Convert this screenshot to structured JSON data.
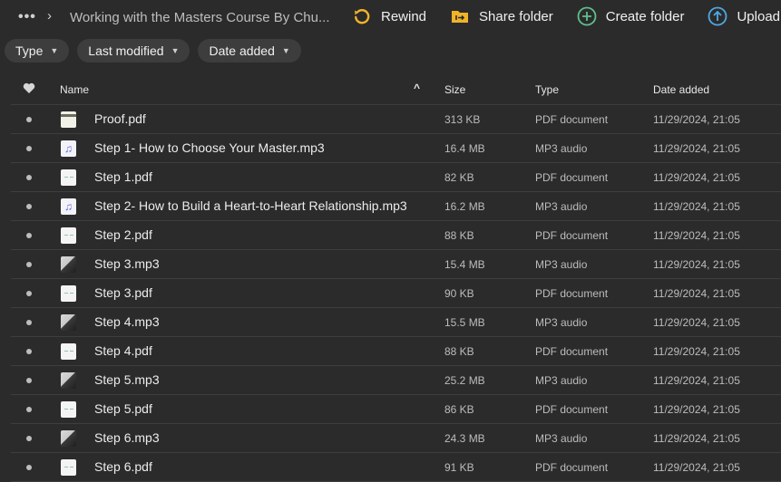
{
  "topbar": {
    "more_label": "•••",
    "separator": "›",
    "breadcrumb": "Working with the Masters Course By Chu...",
    "actions": [
      {
        "label": "Rewind",
        "icon": "rewind-icon",
        "color": "#f0b429"
      },
      {
        "label": "Share folder",
        "icon": "share-folder-icon",
        "color": "#f0b429"
      },
      {
        "label": "Create folder",
        "icon": "create-folder-icon",
        "color": "#5fbf8f"
      },
      {
        "label": "Upload...",
        "icon": "upload-icon",
        "color": "#4fa8e0"
      }
    ]
  },
  "filters": [
    {
      "label": "Type"
    },
    {
      "label": "Last modified"
    },
    {
      "label": "Date added"
    }
  ],
  "columns": {
    "favorite_icon": "heart-icon",
    "name": "Name",
    "sort_indicator": "^",
    "size": "Size",
    "type": "Type",
    "date_added": "Date added"
  },
  "files": [
    {
      "name": "Proof.pdf",
      "size": "313 KB",
      "type": "PDF document",
      "date": "11/29/2024, 21:05",
      "thumb": "proof"
    },
    {
      "name": "Step 1- How to Choose Your Master.mp3",
      "size": "16.4 MB",
      "type": "MP3 audio",
      "date": "11/29/2024, 21:05",
      "thumb": "note"
    },
    {
      "name": "Step 1.pdf",
      "size": "82 KB",
      "type": "PDF document",
      "date": "11/29/2024, 21:05",
      "thumb": "pdf"
    },
    {
      "name": "Step 2- How to Build a Heart-to-Heart Relationship.mp3",
      "size": "16.2 MB",
      "type": "MP3 audio",
      "date": "11/29/2024, 21:05",
      "thumb": "note"
    },
    {
      "name": "Step 2.pdf",
      "size": "88 KB",
      "type": "PDF document",
      "date": "11/29/2024, 21:05",
      "thumb": "pdf"
    },
    {
      "name": "Step 3.mp3",
      "size": "15.4 MB",
      "type": "MP3 audio",
      "date": "11/29/2024, 21:05",
      "thumb": "photo"
    },
    {
      "name": "Step 3.pdf",
      "size": "90 KB",
      "type": "PDF document",
      "date": "11/29/2024, 21:05",
      "thumb": "pdf"
    },
    {
      "name": "Step 4.mp3",
      "size": "15.5 MB",
      "type": "MP3 audio",
      "date": "11/29/2024, 21:05",
      "thumb": "photo"
    },
    {
      "name": "Step 4.pdf",
      "size": "88 KB",
      "type": "PDF document",
      "date": "11/29/2024, 21:05",
      "thumb": "pdf"
    },
    {
      "name": "Step 5.mp3",
      "size": "25.2 MB",
      "type": "MP3 audio",
      "date": "11/29/2024, 21:05",
      "thumb": "photo"
    },
    {
      "name": "Step 5.pdf",
      "size": "86 KB",
      "type": "PDF document",
      "date": "11/29/2024, 21:05",
      "thumb": "pdf"
    },
    {
      "name": "Step 6.mp3",
      "size": "24.3 MB",
      "type": "MP3 audio",
      "date": "11/29/2024, 21:05",
      "thumb": "photo"
    },
    {
      "name": "Step 6.pdf",
      "size": "91 KB",
      "type": "PDF document",
      "date": "11/29/2024, 21:05",
      "thumb": "pdf"
    }
  ]
}
